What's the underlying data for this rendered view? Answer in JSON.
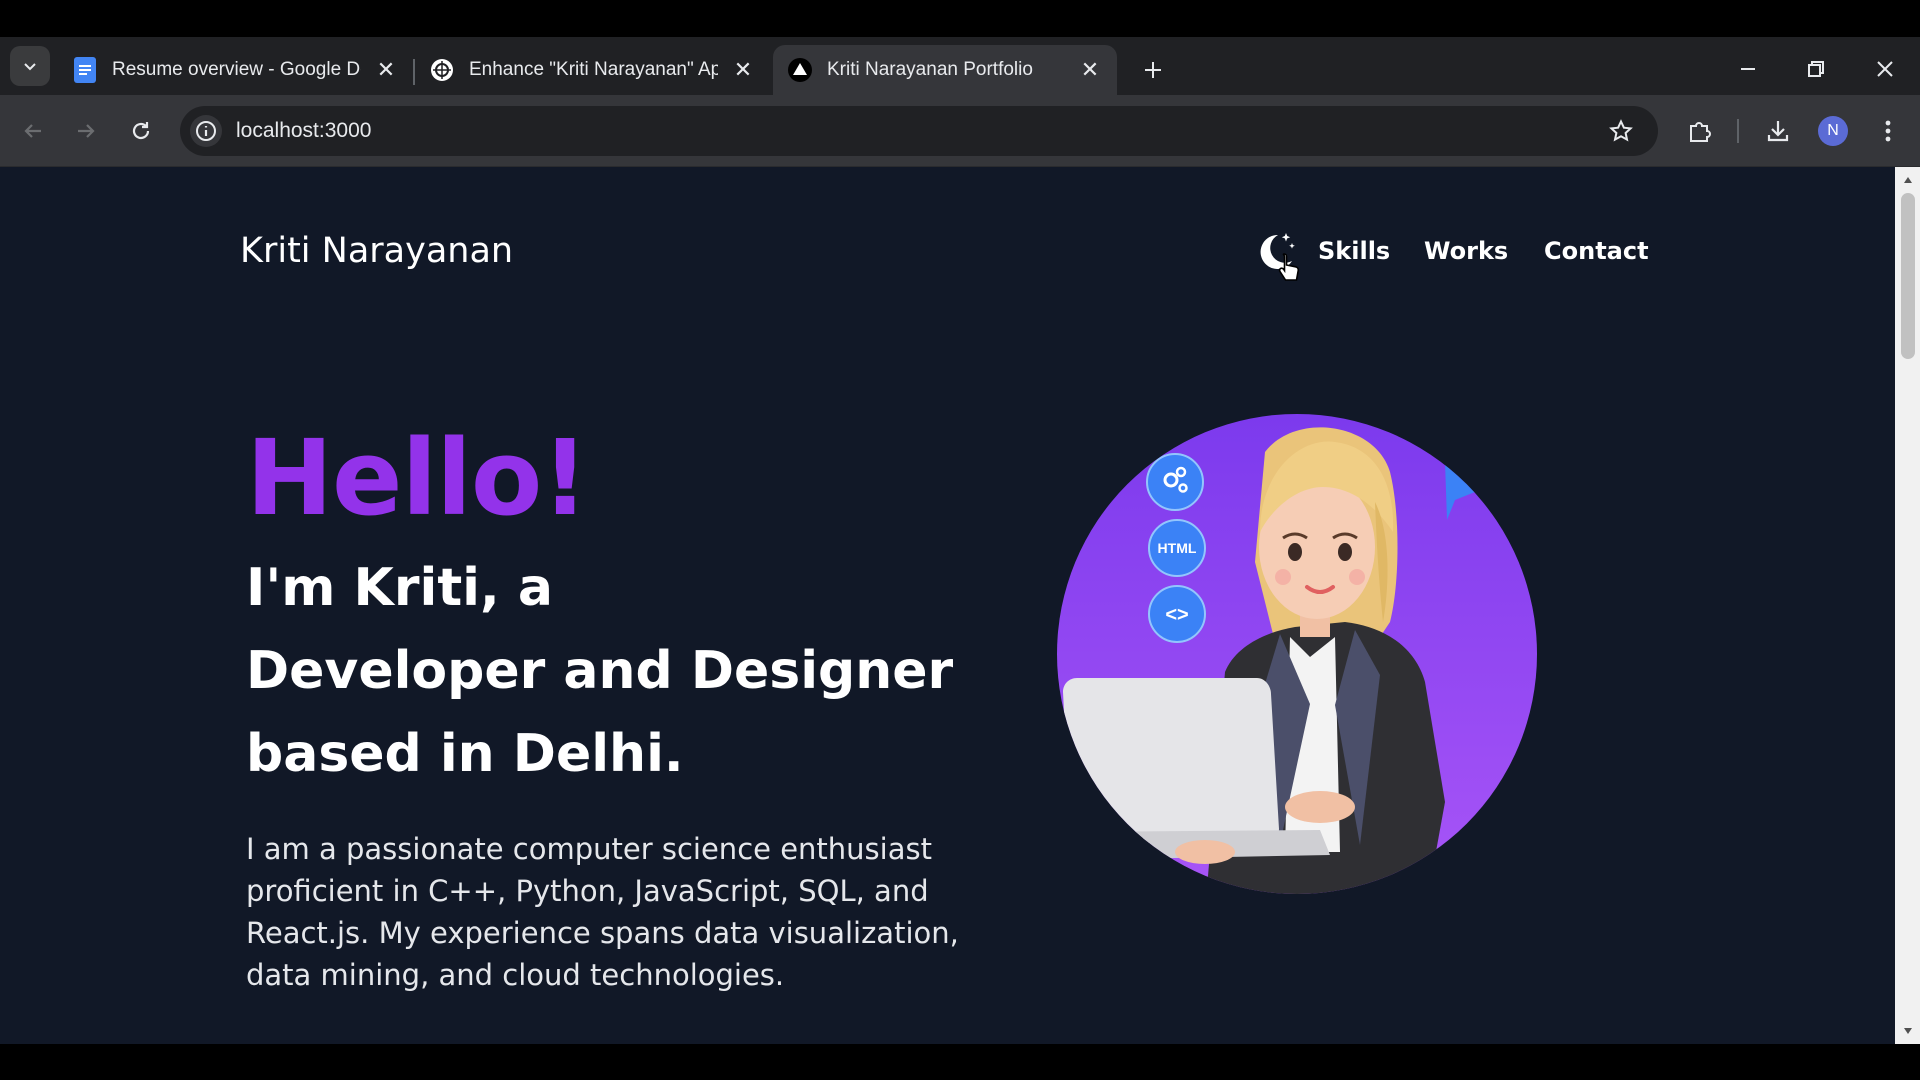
{
  "browser": {
    "tabs": [
      {
        "title": "Resume overview - Google Docs",
        "favicon": "google-docs-icon"
      },
      {
        "title": "Enhance \"Kriti Narayanan\" App",
        "favicon": "chatgpt-icon"
      },
      {
        "title": "Kriti Narayanan Portfolio",
        "favicon": "vercel-triangle-icon",
        "active": true
      }
    ],
    "url": "localhost:3000",
    "profile_initial": "N"
  },
  "page": {
    "brand": "Kriti Narayanan",
    "nav": [
      "Skills",
      "Works",
      "Contact"
    ],
    "hero": {
      "greeting": "Hello!",
      "intro_lines": [
        "I'm Kriti, a",
        "Developer and Designer",
        "based in Delhi."
      ],
      "bio": "I am a passionate computer science enthusiast proficient in C++, Python, JavaScript, SQL, and React.js. My experience spans data visualization, data mining, and cloud technologies.",
      "image_badges": [
        "HTML",
        "<>"
      ]
    }
  },
  "colors": {
    "page_bg": "#111827",
    "accent": "#9333ea",
    "hero_circle_top": "#7c3aed",
    "hero_circle_bottom": "#a855f7"
  }
}
